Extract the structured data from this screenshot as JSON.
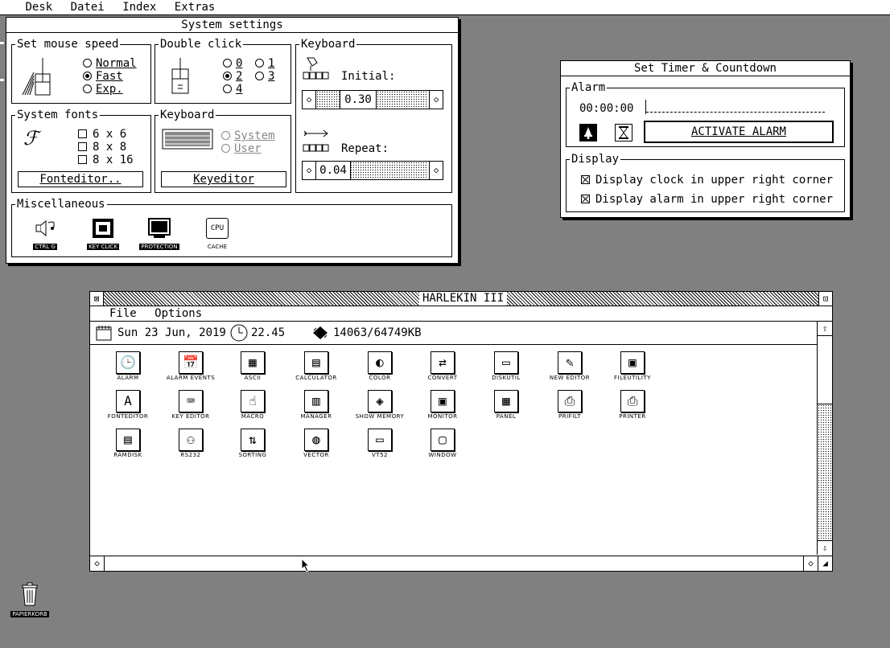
{
  "menubar": {
    "items": [
      "Desk",
      "Datei",
      "Index",
      "Extras"
    ]
  },
  "settings": {
    "title": "System settings",
    "mouse": {
      "title": "Set mouse speed",
      "options": [
        "Normal",
        "Fast",
        "Exp."
      ],
      "selected": "Fast"
    },
    "dblclick": {
      "title": "Double click",
      "options": [
        "0",
        "1",
        "2",
        "3",
        "4"
      ],
      "selected": "2"
    },
    "kbd_timing": {
      "title": "Keyboard",
      "initial_label": "Initial:",
      "initial_value": "0.30",
      "repeat_label": "Repeat:",
      "repeat_value": "0.04"
    },
    "fonts": {
      "title": "System fonts",
      "options": [
        "6 x 6",
        "8 x 8",
        "8 x 16"
      ],
      "button": "Fonteditor.."
    },
    "kbd_layout": {
      "title": "Keyboard",
      "options": [
        "System",
        "User"
      ],
      "button": "Keyeditor"
    },
    "misc": {
      "title": "Miscellaneous",
      "items": [
        "CTRL G",
        "KEY CLICK",
        "PROTECTION",
        "CACHE"
      ],
      "cpu_text": "CPU"
    }
  },
  "timer": {
    "title": "Set Timer & Countdown",
    "alarm_title": "Alarm",
    "time_value": "00:00:00",
    "input_value": "",
    "activate_button": "ACTIVATE ALARM",
    "display_title": "Display",
    "display_options": [
      "Display clock in upper right corner",
      "Display alarm in upper right corner"
    ]
  },
  "harlekin": {
    "title": "HARLEKIN III",
    "menu": [
      "File",
      "Options"
    ],
    "date": "Sun 23 Jun, 2019",
    "time": "22.45",
    "memory": "14063/64749KB",
    "apps": [
      "ALARM",
      "ALARM EVENTS",
      "ASCII",
      "CALCULATOR",
      "COLOR",
      "CONVERT",
      "DISKUTIL",
      "NEW EDITOR",
      "FILEUTILITY",
      "FONTEDITOR",
      "KEY EDITOR",
      "MACRO",
      "MANAGER",
      "SHOW MEMORY",
      "MONITOR",
      "PANEL",
      "PRIFILT",
      "PRINTER",
      "RAMDISK",
      "RS232",
      "SORTING",
      "VECTOR",
      "VT52",
      "WINDOW"
    ],
    "icons": [
      "clock-icon",
      "calendar-icon",
      "ascii-table-icon",
      "calculator-icon",
      "palette-icon",
      "conversion-icon",
      "disk-drive-icon",
      "notepad-pen-icon",
      "file-cabinet-icon",
      "font-a-icon",
      "keyboard-edit-icon",
      "hand-pointer-icon",
      "manager-icon",
      "memory-chip-icon",
      "monitor-icon",
      "control-panel-icon",
      "printer-filter-icon",
      "printer-icon",
      "ram-disk-icon",
      "serial-port-icon",
      "sorting-icon",
      "vector-globe-icon",
      "terminal-icon",
      "window-icon"
    ]
  },
  "desktop": {
    "trash_label": "PAPIERKORB"
  }
}
